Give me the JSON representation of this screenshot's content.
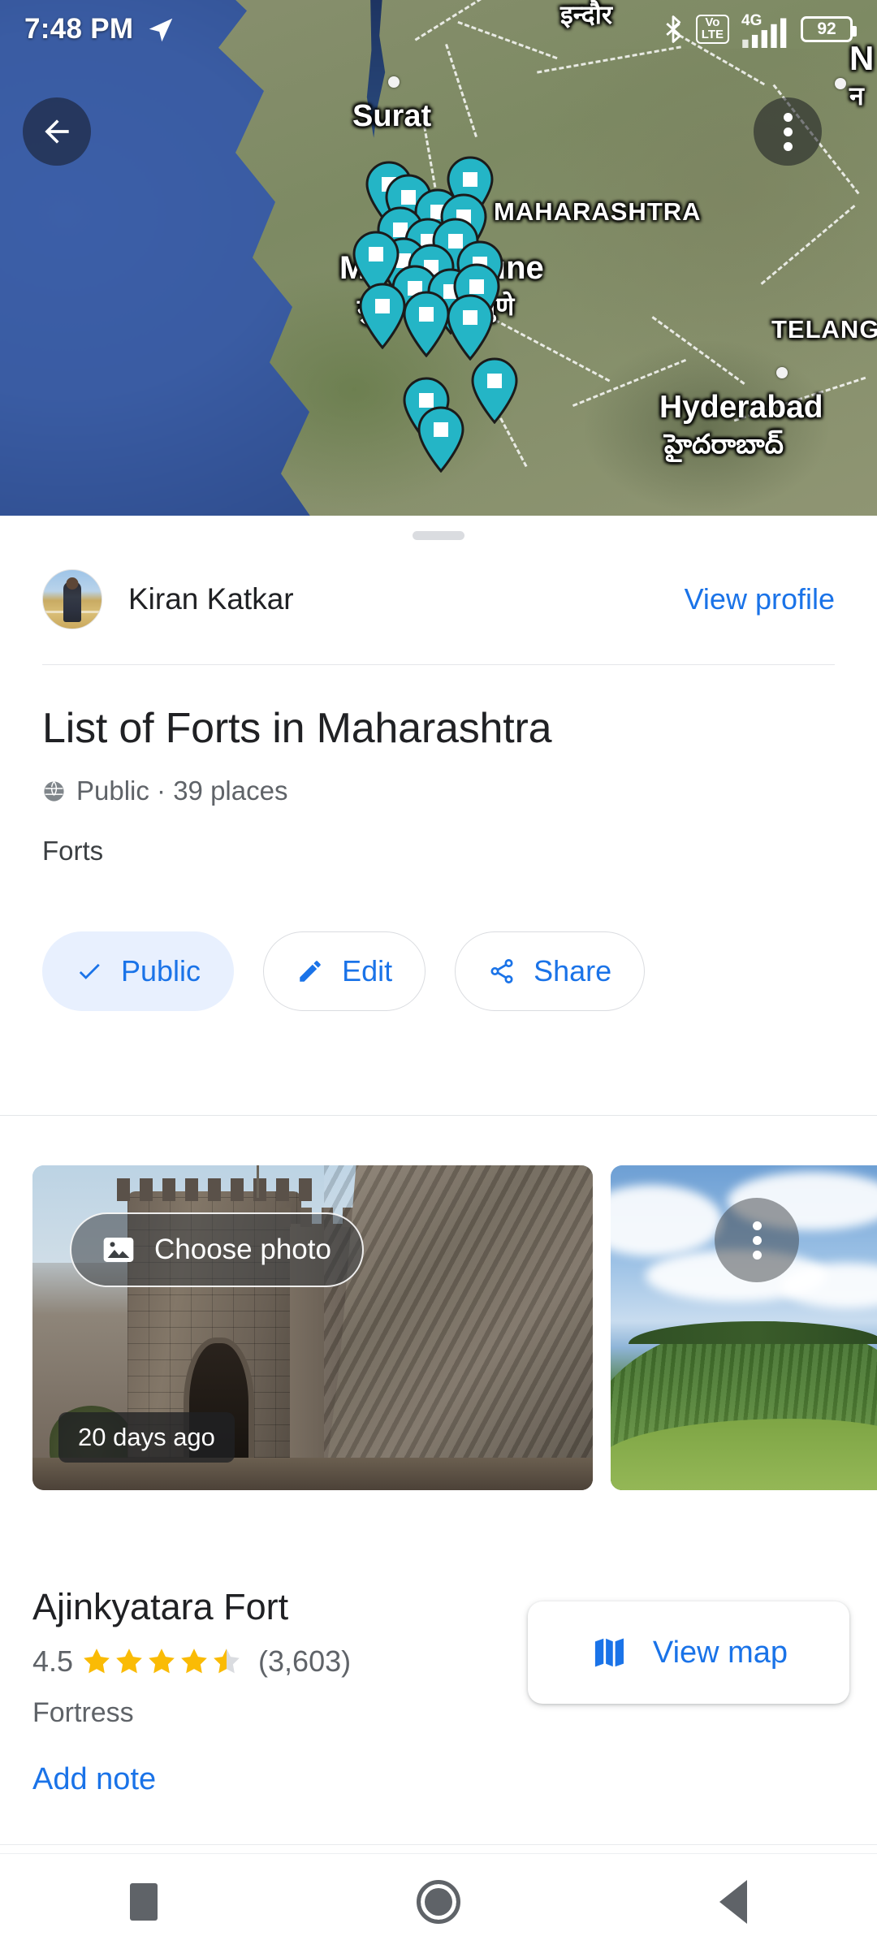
{
  "status_bar": {
    "time": "7:48 PM",
    "nav_icon": "navigation-arrow-icon",
    "bluetooth_icon": "bluetooth-icon",
    "volte_top": "Vo",
    "volte_bottom": "LTE",
    "network_type": "4G",
    "battery_level": "92"
  },
  "map": {
    "back_icon": "back-arrow-icon",
    "overflow_icon": "more-vert-icon",
    "labels": [
      {
        "text": "इन्दौर",
        "sub": ""
      },
      {
        "text": "Surat",
        "sub": ""
      },
      {
        "text": "MAHARASHTRA",
        "sub": ""
      },
      {
        "text": "Mumbai",
        "sub": "मुंबई"
      },
      {
        "text": "Pune",
        "sub": "पुणे"
      },
      {
        "text": "TELANGANA",
        "sub": ""
      },
      {
        "text": "Hyderabad",
        "sub": "హైదరాబాద్"
      }
    ],
    "label_indore": "इन्दौर",
    "label_indore_en": "Indore",
    "label_surat": "Surat",
    "label_maharashtra": "MAHARASHTRA",
    "label_mumbai": "Mumbai",
    "label_mumbai_mr": "मुंबई",
    "label_pune": "Pune",
    "label_pune_mr": "पुणे",
    "label_telangana": "TELANG",
    "label_hyderabad": "Hyderabad",
    "label_hyderabad_te": "హైదరాబాద్",
    "label_n": "N",
    "label_n_sub": "न",
    "pin_color": "#24b5c6",
    "pin_count": 21
  },
  "sheet": {
    "grabber": "drag-handle",
    "profile": {
      "name": "Kiran Katkar",
      "view_profile_label": "View profile",
      "avatar": "user-avatar"
    },
    "list_title": "List of Forts in Maharashtra",
    "visibility_icon": "globe-icon",
    "meta": "Public · 39 places",
    "visibility": "Public",
    "place_count": "39 places",
    "description": "Forts",
    "chips": [
      {
        "label": "Public",
        "icon": "check-icon",
        "active": true
      },
      {
        "label": "Edit",
        "icon": "pencil-icon",
        "active": false
      },
      {
        "label": "Share",
        "icon": "share-icon",
        "active": false
      }
    ]
  },
  "photos": [
    {
      "name": "fort-gate-photo",
      "button_label": "Choose photo",
      "button_icon": "image-icon",
      "timestamp": "20 days ago"
    },
    {
      "name": "green-hill-photo",
      "menu_icon": "more-vert-icon"
    }
  ],
  "place": {
    "name": "Ajinkyatara Fort",
    "rating": "4.5",
    "rating_value": 4.5,
    "review_count": "(3,603)",
    "category": "Fortress",
    "add_note_label": "Add note",
    "star_color": "#fabb05",
    "star_empty_color": "#dadce0"
  },
  "view_map_button": {
    "label": "View map",
    "icon": "map-icon",
    "accent": "#1a73e8"
  },
  "nav_bar": {
    "recents": "square-recents-icon",
    "home": "circle-home-icon",
    "back": "triangle-back-icon"
  }
}
